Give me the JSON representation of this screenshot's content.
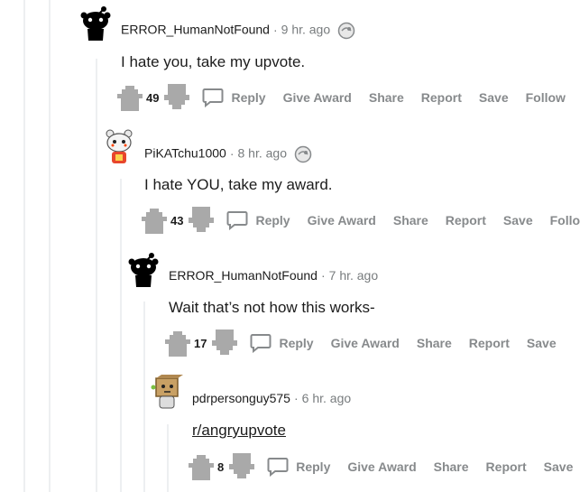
{
  "actions": {
    "reply": "Reply",
    "give_award": "Give Award",
    "share": "Share",
    "report": "Report",
    "save": "Save",
    "follow": "Follow"
  },
  "comments": [
    {
      "author": "ERROR_HumanNotFound",
      "time": "9 hr. ago",
      "body": "I hate you, take my upvote.",
      "score": "49",
      "has_award": true
    },
    {
      "author": "PiKATchu1000",
      "time": "8 hr. ago",
      "body": "I hate YOU, take my award.",
      "score": "43",
      "has_award": true
    },
    {
      "author": "ERROR_HumanNotFound",
      "time": "7 hr. ago",
      "body": "Wait that’s not how this works-",
      "score": "17",
      "has_award": false
    },
    {
      "author": "pdrpersonguy575",
      "time": "6 hr. ago",
      "body": "r/angryupvote",
      "score": "8",
      "has_award": false
    }
  ],
  "colors": {
    "text": "#1c1c1c",
    "meta": "#787c7e",
    "action": "#878a8c",
    "thread_line": "#edeff1",
    "vote": "#a9a9a9"
  },
  "icons": [
    "snoo-avatar-icon",
    "award-icon",
    "upvote-icon",
    "downvote-icon",
    "reply-icon"
  ]
}
